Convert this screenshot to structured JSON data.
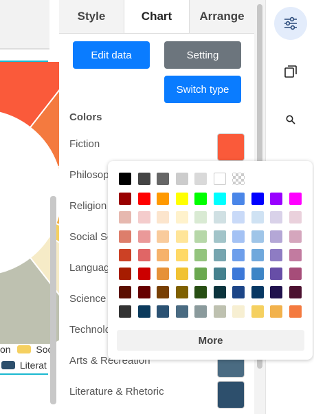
{
  "tabs": [
    {
      "label": "Style"
    },
    {
      "label": "Chart"
    },
    {
      "label": "Arrange"
    }
  ],
  "buttons": {
    "edit_data": "Edit data",
    "setting": "Setting",
    "switch_type": "Switch type"
  },
  "colors_heading": "Colors",
  "color_rows": [
    {
      "label": "Fiction",
      "color": "#fa5a3a"
    },
    {
      "label": "Philosop",
      "color": "#f47a3f"
    },
    {
      "label": "Religion",
      "color": "#f2b24c"
    },
    {
      "label": "Social Sc",
      "color": "#f5d060"
    },
    {
      "label": "Languag",
      "color": "#f6ebc7"
    },
    {
      "label": "Science",
      "color": "#bec1b0"
    },
    {
      "label": "Technolo",
      "color": "#8a9a9c"
    },
    {
      "label": "Arts & Recreation",
      "color": "#4a6b82"
    },
    {
      "label": "Literature & Rhetoric",
      "color": "#2d4f6c"
    }
  ],
  "picker": {
    "more_label": "More",
    "rows": [
      [
        "#000000",
        "#444444",
        "#666666",
        "#cccccc",
        "#d9d9d9",
        "#ffffff",
        "transparent"
      ],
      [
        "#990000",
        "#ff0000",
        "#ff9900",
        "#ffff00",
        "#00ff00",
        "#00ffff",
        "#4a86e8",
        "#0000ff",
        "#9900ff",
        "#ff00ff"
      ],
      [
        "#e6b8af",
        "#f4cccc",
        "#fce5cd",
        "#fff2cc",
        "#d9ead3",
        "#d0e0e3",
        "#c9daf8",
        "#cfe2f3",
        "#d9d2e9",
        "#ead1dc"
      ],
      [
        "#dd7e6b",
        "#ea9999",
        "#f9cb9c",
        "#ffe599",
        "#b6d7a8",
        "#a2c4c9",
        "#a4c2f4",
        "#9fc5e8",
        "#b4a7d6",
        "#d5a6bd"
      ],
      [
        "#cc4125",
        "#e06666",
        "#f6b26b",
        "#ffd966",
        "#93c47d",
        "#76a5af",
        "#6d9eeb",
        "#6fa8dc",
        "#8e7cc3",
        "#c27ba0"
      ],
      [
        "#a61c00",
        "#cc0000",
        "#e69138",
        "#f1c232",
        "#6aa84f",
        "#45818e",
        "#3c78d8",
        "#3d85c6",
        "#674ea7",
        "#a64d79"
      ],
      [
        "#5b0f00",
        "#660000",
        "#783f04",
        "#7f6000",
        "#274e13",
        "#0c343d",
        "#1c4587",
        "#073763",
        "#20124d",
        "#4c1130"
      ],
      [
        "#333333",
        "#0b3a5c",
        "#2b5273",
        "#4a6b82",
        "#8a9a9c",
        "#bec1b0",
        "#f7efd2",
        "#f5d060",
        "#f2b24c",
        "#f47a3f"
      ]
    ]
  },
  "legend": {
    "item1": "on",
    "item2": "Soc",
    "item3": "Literat",
    "item2_color": "#f5d060",
    "item3_color": "#2d4f6c"
  },
  "icons": {
    "settings": "sliders-icon",
    "layers": "layers-icon",
    "search": "search-icon",
    "notes": "notes-icon"
  }
}
